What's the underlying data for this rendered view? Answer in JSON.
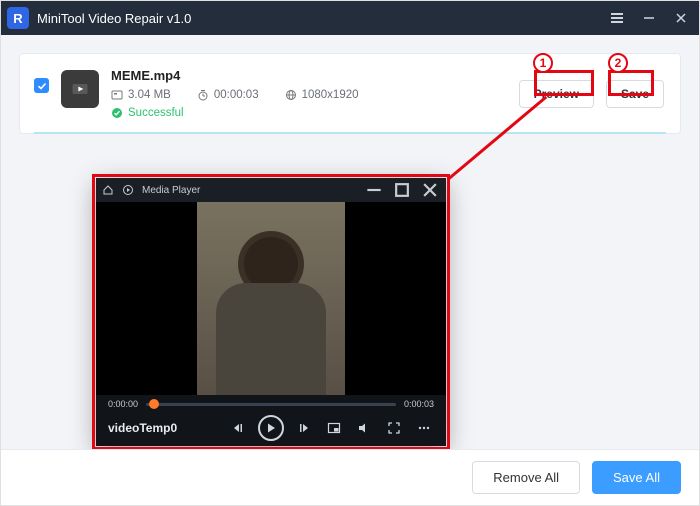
{
  "title": "MiniTool Video Repair v1.0",
  "file": {
    "name": "MEME.mp4",
    "size": "3.04 MB",
    "duration": "00:00:03",
    "resolution": "1080x1920",
    "status": "Successful"
  },
  "actions": {
    "preview": "Preview",
    "save": "Save"
  },
  "footer": {
    "remove_all": "Remove All",
    "save_all": "Save All"
  },
  "media_player": {
    "title": "Media Player",
    "current_time": "0:00:00",
    "total_time": "0:00:03",
    "filename": "videoTemp0"
  },
  "annotations": {
    "step1": "1",
    "step2": "2"
  }
}
